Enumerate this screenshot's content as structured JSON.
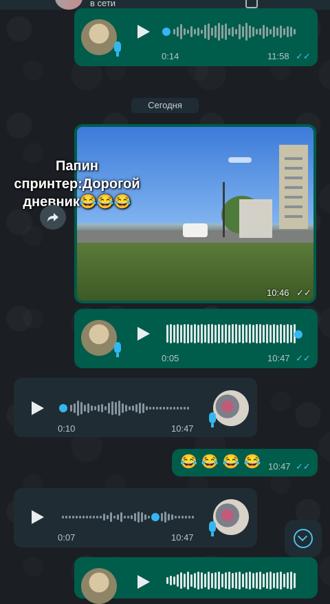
{
  "header": {
    "status": "в сети"
  },
  "date_separator": "Сегодня",
  "messages": [
    {
      "type": "voice",
      "direction": "out",
      "duration": "0:14",
      "time": "11:58",
      "ticks": "✓✓"
    },
    {
      "type": "photo",
      "direction": "out",
      "time": "10:46",
      "ticks": "✓✓",
      "caption": "Папин спринтер:Дорогой дневник😂😂😂"
    },
    {
      "type": "voice",
      "direction": "out",
      "duration": "0:05",
      "time": "10:47",
      "ticks": "✓✓"
    },
    {
      "type": "voice",
      "direction": "in",
      "duration": "0:10",
      "time": "10:47"
    },
    {
      "type": "text",
      "direction": "out",
      "text": "😂😂😂😂",
      "time": "10:47",
      "ticks": "✓✓"
    },
    {
      "type": "voice",
      "direction": "in",
      "duration": "0:07",
      "time": "10:47"
    },
    {
      "type": "voice",
      "direction": "out",
      "duration": "",
      "time": ""
    }
  ],
  "icons": {
    "play": "play-icon",
    "mic": "mic-icon",
    "share": "share-icon",
    "scroll_down": "chevron-down-icon"
  },
  "colors": {
    "outgoing_bubble": "#005c4b",
    "incoming_bubble": "#202c33",
    "accent": "#34b7f1",
    "read_ticks": "#53bdeb"
  }
}
